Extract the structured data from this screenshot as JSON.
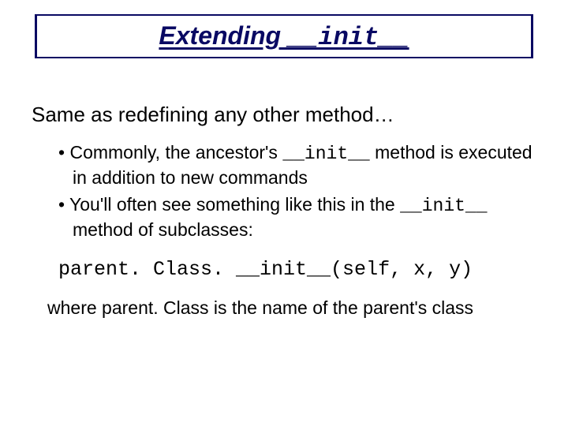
{
  "title": {
    "text_plain": "Extending ",
    "text_mono": "__init__"
  },
  "lead": "Same as redefining any other method…",
  "bullets": [
    {
      "pre": "Commonly, the ancestor's ",
      "mono": "__init__",
      "post": " method is executed in addition to new commands"
    },
    {
      "pre": "You'll often see something like this in the ",
      "mono": "__init__",
      "post": " method of subclasses:"
    }
  ],
  "code": "parent. Class. __init__(self, x, y)",
  "closing": "where parent. Class is the name of the parent's class"
}
